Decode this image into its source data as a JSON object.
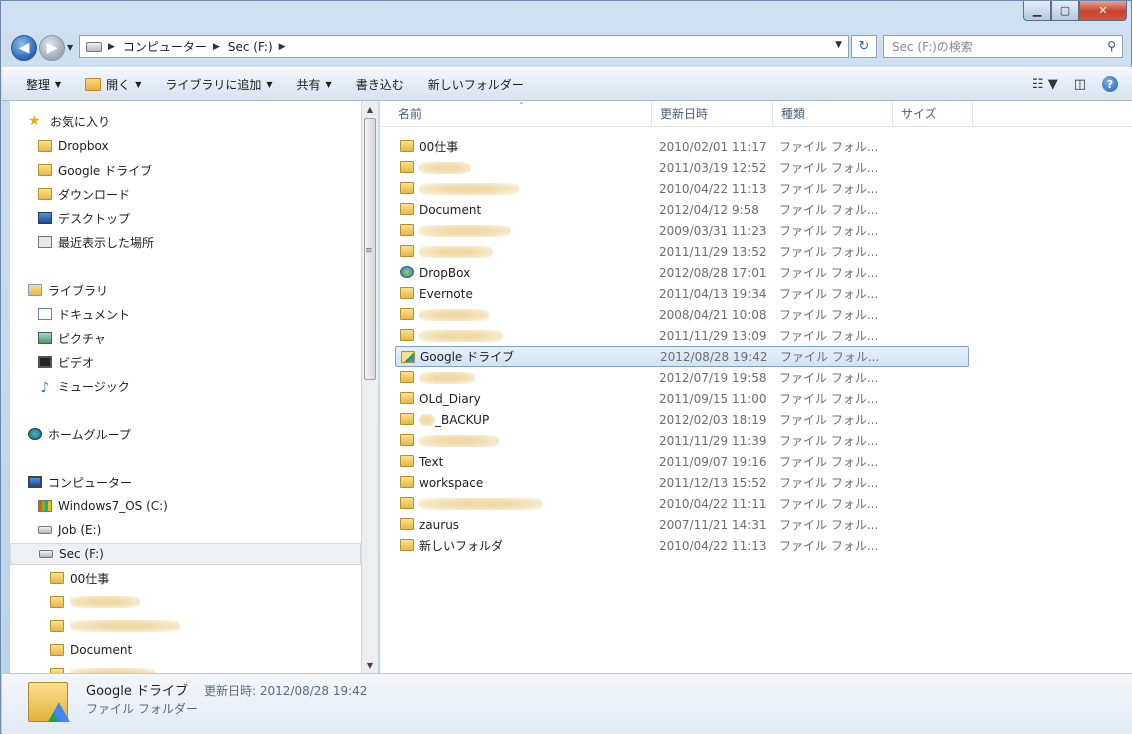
{
  "titlebar": {
    "minimize": "▁",
    "maximize": "▢",
    "close": "✕"
  },
  "address": {
    "segments": [
      "コンピューター",
      "Sec (F:)"
    ]
  },
  "search": {
    "placeholder": "Sec (F:)の検索"
  },
  "toolbar": {
    "organize": "整理",
    "open": "開く",
    "include_library": "ライブラリに追加",
    "share": "共有",
    "burn": "書き込む",
    "new_folder": "新しいフォルダー",
    "help": "?"
  },
  "nav": {
    "favorites": "お気に入り",
    "dropbox": "Dropbox",
    "google_drive": "Google ドライブ",
    "downloads": "ダウンロード",
    "desktop": "デスクトップ",
    "recent": "最近表示した場所",
    "libraries": "ライブラリ",
    "documents": "ドキュメント",
    "pictures": "ピクチャ",
    "videos": "ビデオ",
    "music": "ミュージック",
    "homegroup": "ホームグループ",
    "computer": "コンピューター",
    "drive_c": "Windows7_OS (C:)",
    "drive_e": "Job (E:)",
    "drive_f": "Sec (F:)",
    "sub_00": "00仕事",
    "sub_doc": "Document"
  },
  "columns": {
    "name": "名前",
    "date": "更新日時",
    "type": "種類",
    "size": "サイズ"
  },
  "files": [
    {
      "name": "00仕事",
      "date": "2010/02/01 11:17",
      "type": "ファイル フォル..."
    },
    {
      "name": "",
      "date": "2011/03/19 12:52",
      "type": "ファイル フォル..."
    },
    {
      "name": "",
      "date": "2010/04/22 11:13",
      "type": "ファイル フォル..."
    },
    {
      "name": "Document",
      "date": "2012/04/12 9:58",
      "type": "ファイル フォル..."
    },
    {
      "name": "",
      "date": "2009/03/31 11:23",
      "type": "ファイル フォル..."
    },
    {
      "name": "",
      "date": "2011/11/29 13:52",
      "type": "ファイル フォル..."
    },
    {
      "name": "DropBox",
      "date": "2012/08/28 17:01",
      "type": "ファイル フォル..."
    },
    {
      "name": "Evernote",
      "date": "2011/04/13 19:34",
      "type": "ファイル フォル..."
    },
    {
      "name": "",
      "date": "2008/04/21 10:08",
      "type": "ファイル フォル..."
    },
    {
      "name": "",
      "date": "2011/11/29 13:09",
      "type": "ファイル フォル..."
    },
    {
      "name": "Google ドライブ",
      "date": "2012/08/28 19:42",
      "type": "ファイル フォル..."
    },
    {
      "name": "",
      "date": "2012/07/19 19:58",
      "type": "ファイル フォル..."
    },
    {
      "name": "OLd_Diary",
      "date": "2011/09/15 11:00",
      "type": "ファイル フォル..."
    },
    {
      "name": "_BACKUP",
      "date": "2012/02/03 18:19",
      "type": "ファイル フォル..."
    },
    {
      "name": "",
      "date": "2011/11/29 11:39",
      "type": "ファイル フォル..."
    },
    {
      "name": "Text",
      "date": "2011/09/07 19:16",
      "type": "ファイル フォル..."
    },
    {
      "name": "workspace",
      "date": "2011/12/13 15:52",
      "type": "ファイル フォル..."
    },
    {
      "name": "",
      "date": "2010/04/22 11:11",
      "type": "ファイル フォル..."
    },
    {
      "name": "zaurus",
      "date": "2007/11/21 14:31",
      "type": "ファイル フォル..."
    },
    {
      "name": "新しいフォルダ",
      "date": "2010/04/22 11:13",
      "type": "ファイル フォル..."
    }
  ],
  "details": {
    "name": "Google ドライブ",
    "date_label": "更新日時: 2012/08/28 19:42",
    "type": "ファイル フォルダー"
  }
}
